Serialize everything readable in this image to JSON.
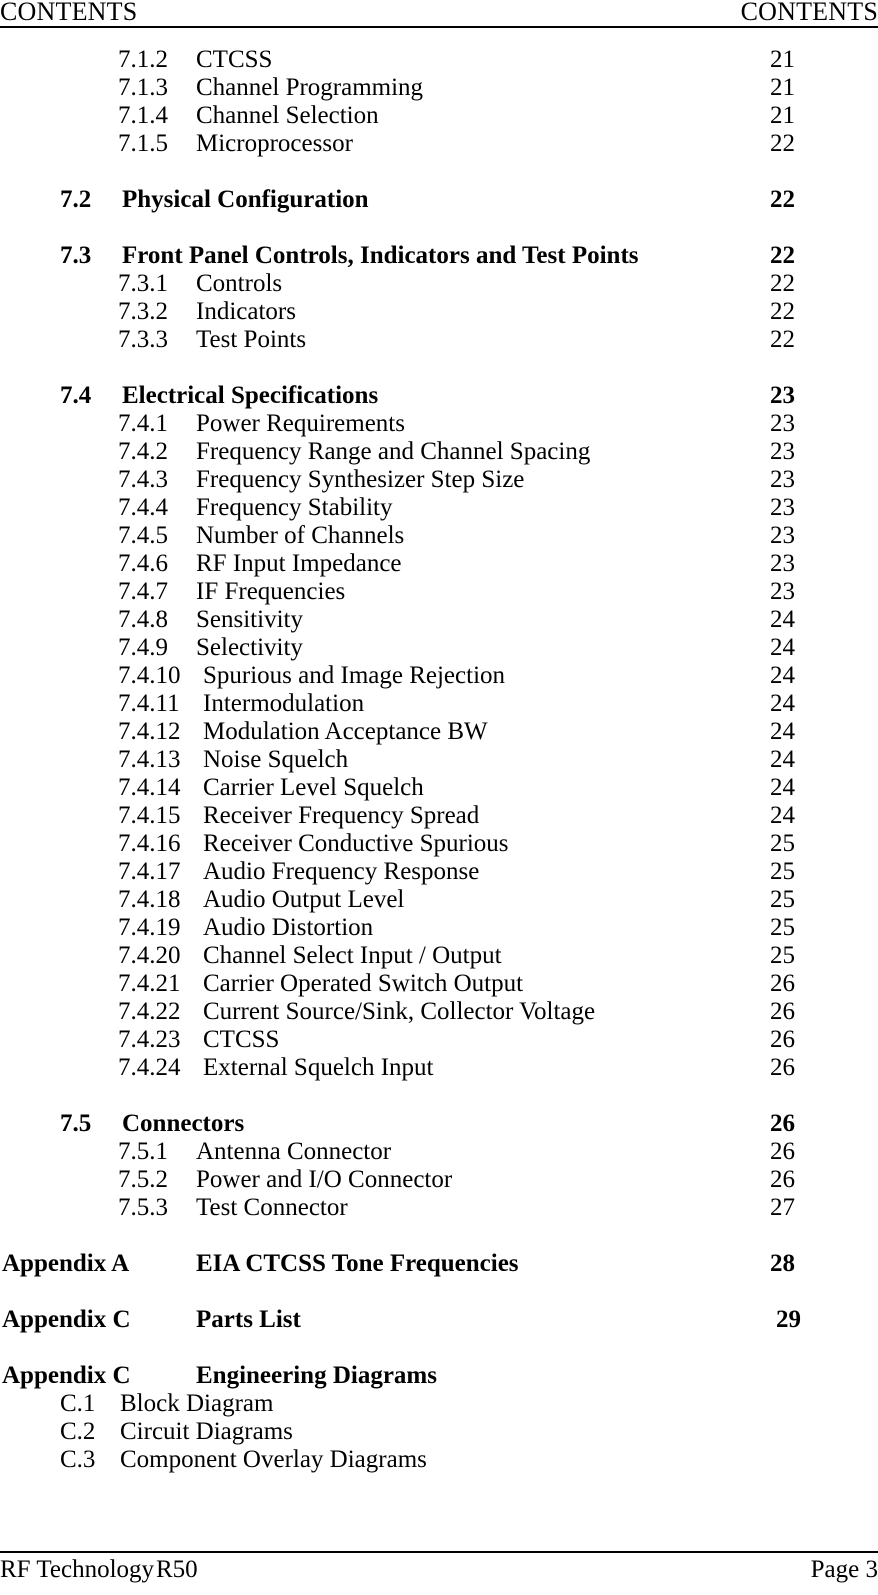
{
  "header": {
    "left": "CONTENTS",
    "right": "CONTENTS"
  },
  "footer": {
    "company": "RF Technology",
    "model": "R50",
    "page_label": "Page 3"
  },
  "toc": {
    "entries": [
      {
        "num": "7.1.2",
        "title": "CTCSS",
        "page": "21"
      },
      {
        "num": "7.1.3",
        "title": "Channel Programming",
        "page": "21"
      },
      {
        "num": "7.1.4",
        "title": "Channel Selection",
        "page": "21"
      },
      {
        "num": "7.1.5",
        "title": "Microprocessor",
        "page": "22"
      },
      {
        "num": "7.2",
        "title": "Physical Configuration",
        "page": "22"
      },
      {
        "num": "7.3",
        "title": "Front Panel Controls, Indicators and Test Points",
        "page": "22"
      },
      {
        "num": "7.3.1",
        "title": "Controls",
        "page": "22"
      },
      {
        "num": "7.3.2",
        "title": "Indicators",
        "page": "22"
      },
      {
        "num": "7.3.3",
        "title": "Test Points",
        "page": "22"
      },
      {
        "num": "7.4",
        "title": "Electrical Specifications",
        "page": "23"
      },
      {
        "num": "7.4.1",
        "title": "Power Requirements",
        "page": "23"
      },
      {
        "num": "7.4.2",
        "title": "Frequency Range and Channel Spacing",
        "page": "23"
      },
      {
        "num": "7.4.3",
        "title": "Frequency Synthesizer Step Size",
        "page": "23"
      },
      {
        "num": "7.4.4",
        "title": "Frequency Stability",
        "page": "23"
      },
      {
        "num": "7.4.5",
        "title": "Number of Channels",
        "page": "23"
      },
      {
        "num": "7.4.6",
        "title": "RF Input Impedance",
        "page": "23"
      },
      {
        "num": "7.4.7",
        "title": "IF Frequencies",
        "page": "23"
      },
      {
        "num": "7.4.8",
        "title": "Sensitivity",
        "page": "24"
      },
      {
        "num": "7.4.9",
        "title": "Selectivity",
        "page": "24"
      },
      {
        "num": "7.4.10",
        "title": "Spurious and Image Rejection",
        "page": "24"
      },
      {
        "num": "7.4.11",
        "title": "Intermodulation",
        "page": "24"
      },
      {
        "num": "7.4.12",
        "title": "Modulation Acceptance BW",
        "page": "24"
      },
      {
        "num": "7.4.13",
        "title": "Noise Squelch",
        "page": "24"
      },
      {
        "num": "7.4.14",
        "title": "Carrier Level Squelch",
        "page": "24"
      },
      {
        "num": "7.4.15",
        "title": "Receiver Frequency Spread",
        "page": "24"
      },
      {
        "num": "7.4.16",
        "title": "Receiver Conductive Spurious",
        "page": "25"
      },
      {
        "num": "7.4.17",
        "title": "Audio Frequency Response",
        "page": "25"
      },
      {
        "num": "7.4.18",
        "title": "Audio Output Level",
        "page": "25"
      },
      {
        "num": "7.4.19",
        "title": "Audio Distortion",
        "page": "25"
      },
      {
        "num": "7.4.20",
        "title": "Channel Select Input / Output",
        "page": "25"
      },
      {
        "num": "7.4.21",
        "title": "Carrier Operated Switch Output",
        "page": "26"
      },
      {
        "num": "7.4.22",
        "title": "Current Source/Sink, Collector Voltage",
        "page": "26"
      },
      {
        "num": "7.4.23",
        "title": "CTCSS",
        "page": "26"
      },
      {
        "num": "7.4.24",
        "title": "External Squelch Input",
        "page": "26"
      },
      {
        "num": "7.5",
        "title": "Connectors",
        "page": "26"
      },
      {
        "num": "7.5.1",
        "title": "Antenna Connector",
        "page": "26"
      },
      {
        "num": "7.5.2",
        "title": "Power and I/O Connector",
        "page": "26"
      },
      {
        "num": "7.5.3",
        "title": "Test Connector",
        "page": "27"
      },
      {
        "num": "Appendix A",
        "title": "EIA CTCSS Tone Frequencies",
        "page": "28"
      },
      {
        "num": "Appendix C",
        "title": "Parts List",
        "page": "29"
      },
      {
        "num": "Appendix C",
        "title": "Engineering Diagrams",
        "page": ""
      },
      {
        "num": "C.1",
        "title": "Block Diagram",
        "page": ""
      },
      {
        "num": "C.2",
        "title": "Circuit Diagrams",
        "page": ""
      },
      {
        "num": "C.3",
        "title": "Component Overlay Diagrams",
        "page": ""
      }
    ]
  }
}
